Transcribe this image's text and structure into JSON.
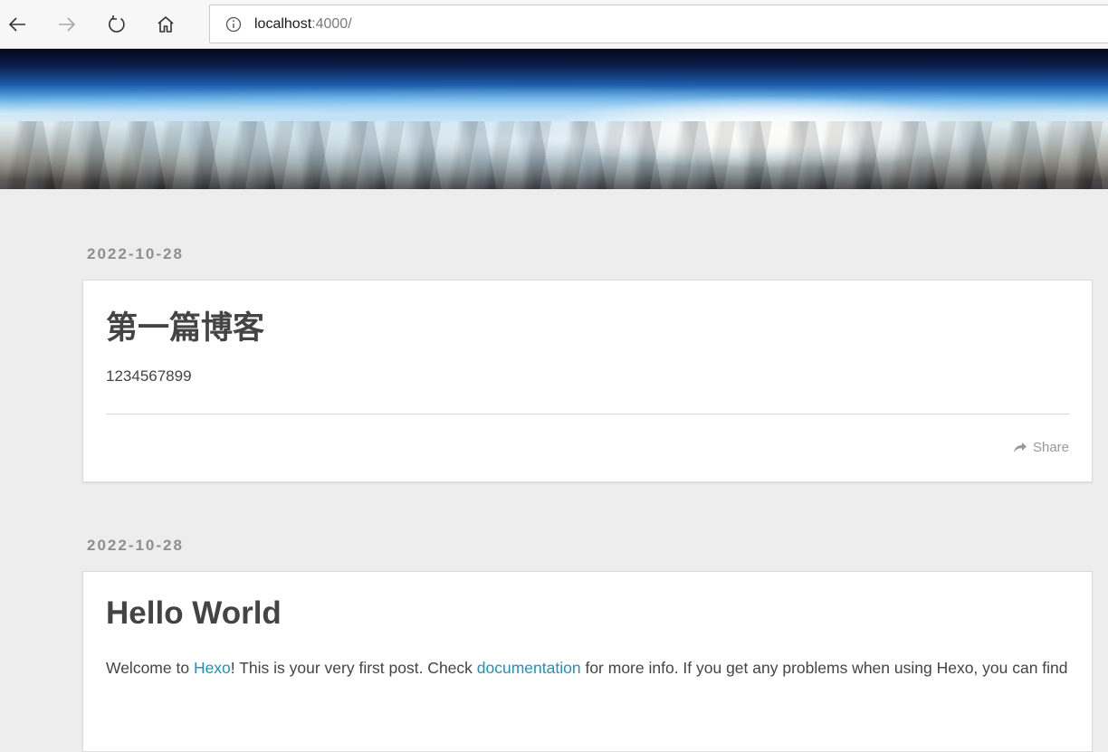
{
  "browser": {
    "url_host": "localhost",
    "url_rest": ":4000/",
    "icons": [
      "back-arrow-icon",
      "forward-arrow-icon",
      "refresh-icon",
      "home-icon",
      "info-icon"
    ]
  },
  "posts": [
    {
      "date": "2022-10-28",
      "title": "第一篇博客",
      "body": "1234567899",
      "share_label": "Share"
    },
    {
      "date": "2022-10-28",
      "title": "Hello World",
      "body": {
        "part1": "Welcome to ",
        "link1": "Hexo",
        "part2": "! This is your very first post. Check ",
        "link2": "documentation",
        "part3": " for more info. If you get any problems when using Hexo, you can find"
      }
    }
  ],
  "colors": {
    "link": "#258fb8",
    "title": "#444444",
    "date": "#8f8f8f",
    "page_bg": "#ededed"
  }
}
